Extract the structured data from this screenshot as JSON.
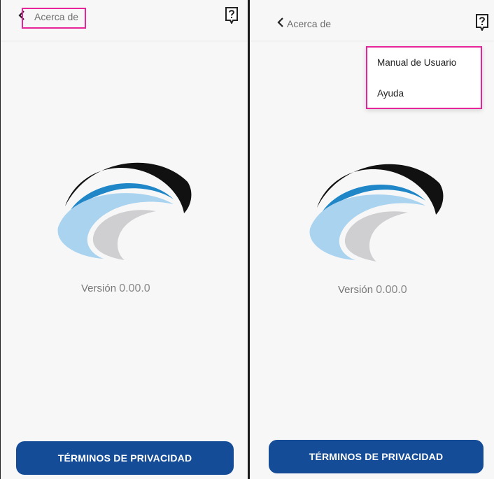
{
  "left_screen": {
    "header": {
      "title": "Acerca de"
    },
    "version": {
      "label": "Versión",
      "number": "0.00.0"
    },
    "terms_button": {
      "label": "TÉRMINOS DE PRIVACIDAD"
    }
  },
  "right_screen": {
    "header": {
      "title": "Acerca de"
    },
    "menu": {
      "items": [
        "Manual de Usuario",
        "Ayuda"
      ]
    },
    "version": {
      "label": "Versión",
      "number": "0.00.0"
    },
    "terms_button": {
      "label": "TÉRMINOS DE PRIVACIDAD"
    }
  },
  "colors": {
    "button": "#154c98",
    "highlight": "#e8249a",
    "logo_black": "#111111",
    "logo_blue": "#1f86c8",
    "logo_light_blue": "#a9d3ef",
    "logo_gray": "#cfcfd1"
  },
  "icons": {
    "back": "chevron-left-icon",
    "help": "question-mark-icon",
    "logo": "swoosh-logo"
  }
}
